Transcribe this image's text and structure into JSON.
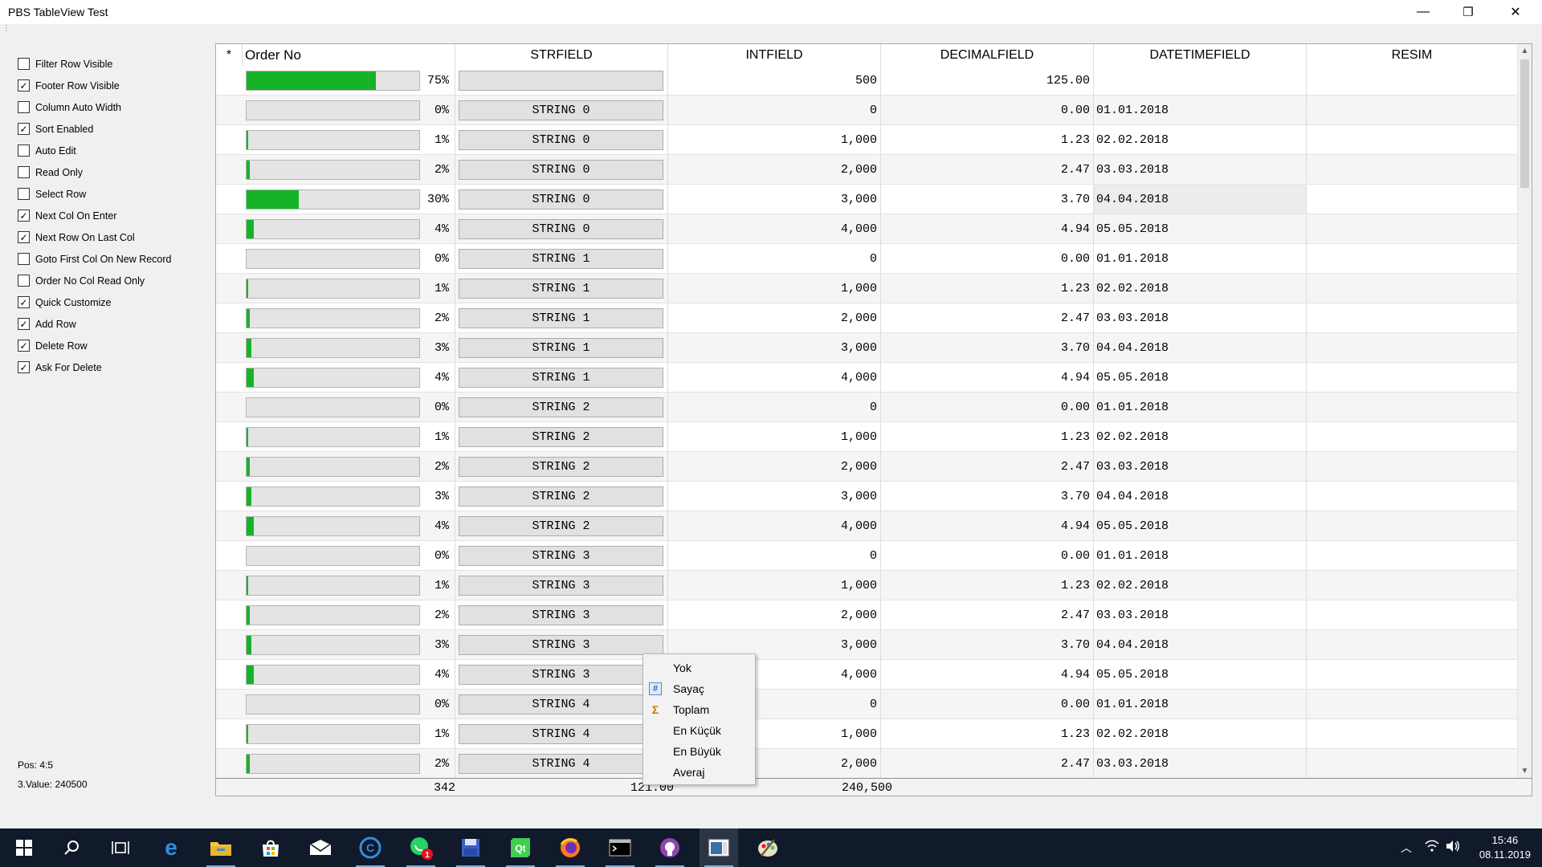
{
  "window": {
    "title": "PBS TableView Test",
    "minimize": "—",
    "maximize": "❐",
    "close": "✕",
    "grip": "⋮"
  },
  "options": [
    {
      "label": "Filter Row Visible",
      "checked": false
    },
    {
      "label": "Footer Row Visible",
      "checked": true
    },
    {
      "label": "Column Auto Width",
      "checked": false
    },
    {
      "label": "Sort Enabled",
      "checked": true
    },
    {
      "label": "Auto Edit",
      "checked": false
    },
    {
      "label": "Read Only",
      "checked": false
    },
    {
      "label": "Select Row",
      "checked": false
    },
    {
      "label": "Next Col On Enter",
      "checked": true
    },
    {
      "label": "Next Row On Last Col",
      "checked": true
    },
    {
      "label": "Goto First Col On New Record",
      "checked": false
    },
    {
      "label": "Order No Col Read Only",
      "checked": false
    },
    {
      "label": "Quick Customize",
      "checked": true
    },
    {
      "label": "Add Row",
      "checked": true
    },
    {
      "label": "Delete Row",
      "checked": true
    },
    {
      "label": "Ask For Delete",
      "checked": true
    }
  ],
  "status": {
    "pos": "Pos: 4:5",
    "value": "3.Value: 240500"
  },
  "grid": {
    "indicator": "*",
    "columns": [
      "Order No",
      "STRFIELD",
      "INTFIELD",
      "DECIMALFIELD",
      "DATETIMEFIELD",
      "RESIM"
    ],
    "rows": [
      {
        "pct": 75,
        "pct_text": "75%",
        "str": "",
        "int": "500",
        "dec": "125.00",
        "date": ""
      },
      {
        "pct": 0,
        "pct_text": "0%",
        "str": "STRING 0",
        "int": "0",
        "dec": "0.00",
        "date": "01.01.2018"
      },
      {
        "pct": 1,
        "pct_text": "1%",
        "str": "STRING 0",
        "int": "1,000",
        "dec": "1.23",
        "date": "02.02.2018"
      },
      {
        "pct": 2,
        "pct_text": "2%",
        "str": "STRING 0",
        "int": "2,000",
        "dec": "2.47",
        "date": "03.03.2018"
      },
      {
        "pct": 30,
        "pct_text": "30%",
        "str": "STRING 0",
        "int": "3,000",
        "dec": "3.70",
        "date": "04.04.2018"
      },
      {
        "pct": 4,
        "pct_text": "4%",
        "str": "STRING 0",
        "int": "4,000",
        "dec": "4.94",
        "date": "05.05.2018"
      },
      {
        "pct": 0,
        "pct_text": "0%",
        "str": "STRING 1",
        "int": "0",
        "dec": "0.00",
        "date": "01.01.2018"
      },
      {
        "pct": 1,
        "pct_text": "1%",
        "str": "STRING 1",
        "int": "1,000",
        "dec": "1.23",
        "date": "02.02.2018"
      },
      {
        "pct": 2,
        "pct_text": "2%",
        "str": "STRING 1",
        "int": "2,000",
        "dec": "2.47",
        "date": "03.03.2018"
      },
      {
        "pct": 3,
        "pct_text": "3%",
        "str": "STRING 1",
        "int": "3,000",
        "dec": "3.70",
        "date": "04.04.2018"
      },
      {
        "pct": 4,
        "pct_text": "4%",
        "str": "STRING 1",
        "int": "4,000",
        "dec": "4.94",
        "date": "05.05.2018"
      },
      {
        "pct": 0,
        "pct_text": "0%",
        "str": "STRING 2",
        "int": "0",
        "dec": "0.00",
        "date": "01.01.2018"
      },
      {
        "pct": 1,
        "pct_text": "1%",
        "str": "STRING 2",
        "int": "1,000",
        "dec": "1.23",
        "date": "02.02.2018"
      },
      {
        "pct": 2,
        "pct_text": "2%",
        "str": "STRING 2",
        "int": "2,000",
        "dec": "2.47",
        "date": "03.03.2018"
      },
      {
        "pct": 3,
        "pct_text": "3%",
        "str": "STRING 2",
        "int": "3,000",
        "dec": "3.70",
        "date": "04.04.2018"
      },
      {
        "pct": 4,
        "pct_text": "4%",
        "str": "STRING 2",
        "int": "4,000",
        "dec": "4.94",
        "date": "05.05.2018"
      },
      {
        "pct": 0,
        "pct_text": "0%",
        "str": "STRING 3",
        "int": "0",
        "dec": "0.00",
        "date": "01.01.2018"
      },
      {
        "pct": 1,
        "pct_text": "1%",
        "str": "STRING 3",
        "int": "1,000",
        "dec": "1.23",
        "date": "02.02.2018"
      },
      {
        "pct": 2,
        "pct_text": "2%",
        "str": "STRING 3",
        "int": "2,000",
        "dec": "2.47",
        "date": "03.03.2018"
      },
      {
        "pct": 3,
        "pct_text": "3%",
        "str": "STRING 3",
        "int": "3,000",
        "dec": "3.70",
        "date": "04.04.2018"
      },
      {
        "pct": 4,
        "pct_text": "4%",
        "str": "STRING 3",
        "int": "4,000",
        "dec": "4.94",
        "date": "05.05.2018"
      },
      {
        "pct": 0,
        "pct_text": "0%",
        "str": "STRING 4",
        "int": "0",
        "dec": "0.00",
        "date": "01.01.2018"
      },
      {
        "pct": 1,
        "pct_text": "1%",
        "str": "STRING 4",
        "int": "1,000",
        "dec": "1.23",
        "date": "02.02.2018"
      },
      {
        "pct": 2,
        "pct_text": "2%",
        "str": "STRING 4",
        "int": "2,000",
        "dec": "2.47",
        "date": "03.03.2018"
      }
    ],
    "current_row": 4,
    "footer": {
      "order": "342",
      "str": "121.00",
      "int": "240,500"
    }
  },
  "context_menu": {
    "items": [
      "Yok",
      "Sayaç",
      "Toplam",
      "En Küçük",
      "En Büyük",
      "Averaj"
    ]
  },
  "taskbar": {
    "icons": [
      "windows-start-icon",
      "search-icon",
      "task-view-icon",
      "edge-icon",
      "file-explorer-icon",
      "store-icon",
      "mail-icon",
      "ccleaner-icon",
      "whatsapp-icon",
      "save-disk-icon",
      "qt-creator-icon",
      "firefox-icon",
      "terminal-icon",
      "github-icon",
      "tableview-app-icon",
      "paint-icon"
    ],
    "whatsapp_badge": "1",
    "time": "15:46",
    "date": "08.11.2019"
  },
  "colors": {
    "progress": "#16b328",
    "taskbar": "#101a2a"
  }
}
